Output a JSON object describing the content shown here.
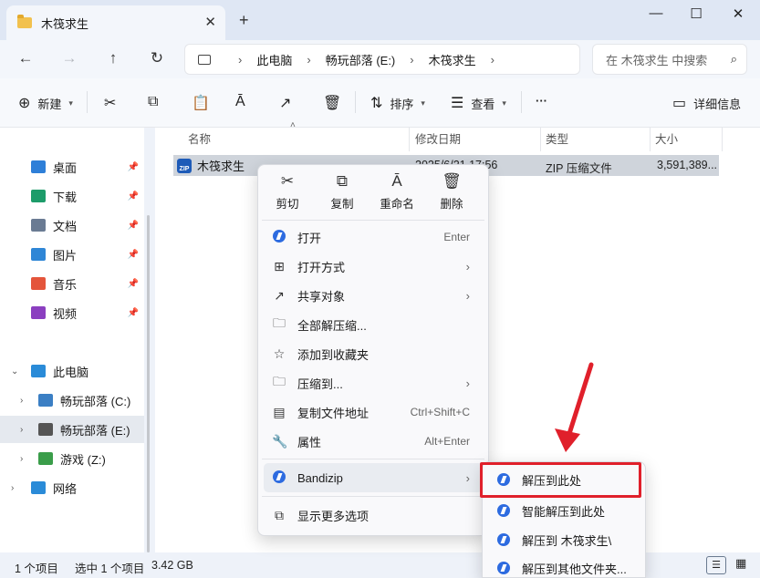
{
  "window": {
    "tab_title": "木筏求生",
    "new_tab": "+",
    "tab_close": "✕",
    "minimize": "—",
    "maximize": "☐",
    "close": "✕"
  },
  "nav": {
    "back": "←",
    "forward": "→",
    "up": "↑",
    "refresh": "↻",
    "breadcrumb": [
      "此电脑",
      "畅玩部落 (E:)",
      "木筏求生"
    ],
    "search_placeholder": "在 木筏求生 中搜索"
  },
  "toolbar": {
    "new": "新建",
    "sort": "排序",
    "view": "查看",
    "more": "···",
    "details": "详细信息"
  },
  "sidebar": {
    "quick_access": [
      {
        "label": "桌面",
        "color": "#2e7fd8"
      },
      {
        "label": "下载",
        "color": "#1d9c6a"
      },
      {
        "label": "文档",
        "color": "#6a7b93"
      },
      {
        "label": "图片",
        "color": "#2f86d6"
      },
      {
        "label": "音乐",
        "color": "#e4553b"
      },
      {
        "label": "视频",
        "color": "#8b3fc0"
      }
    ],
    "this_pc": "此电脑",
    "drives": [
      {
        "label": "畅玩部落 (C:)"
      },
      {
        "label": "畅玩部落 (E:)"
      },
      {
        "label": "游戏 (Z:)"
      }
    ],
    "network": "网络"
  },
  "columns": {
    "name": "名称",
    "date": "修改日期",
    "type": "类型",
    "size": "大小"
  },
  "file": {
    "name": "木筏求生",
    "date": "2025/6/21 17:56",
    "type": "ZIP 压缩文件",
    "size": "3,591,389..."
  },
  "status": {
    "count": "1 个项目",
    "selected": "选中 1 个项目",
    "size": "3.42 GB"
  },
  "context_menu": {
    "top_actions": [
      {
        "label": "剪切",
        "icon": "scissors-icon",
        "glyph": "✂"
      },
      {
        "label": "复制",
        "icon": "copy-icon",
        "glyph": "⧉"
      },
      {
        "label": "重命名",
        "icon": "rename-icon",
        "glyph": "Ā"
      },
      {
        "label": "删除",
        "icon": "trash-icon",
        "glyph": "🗑"
      }
    ],
    "items": [
      {
        "label": "打开",
        "shortcut": "Enter"
      },
      {
        "label": "打开方式",
        "arrow": "›"
      },
      {
        "label": "共享对象",
        "arrow": "›"
      },
      {
        "label": "全部解压缩..."
      },
      {
        "label": "添加到收藏夹"
      },
      {
        "label": "压缩到...",
        "arrow": "›"
      },
      {
        "label": "复制文件地址",
        "shortcut": "Ctrl+Shift+C"
      },
      {
        "label": "属性",
        "shortcut": "Alt+Enter"
      }
    ],
    "bandizip": "Bandizip",
    "bandizip_arrow": "›",
    "more_options": "显示更多选项"
  },
  "submenu": {
    "items": [
      "解压到此处",
      "智能解压到此处",
      "解压到 木筏求生\\",
      "解压到其他文件夹..."
    ]
  },
  "colors": {
    "highlight": "#e0202b",
    "accent": "#2d6be0"
  }
}
